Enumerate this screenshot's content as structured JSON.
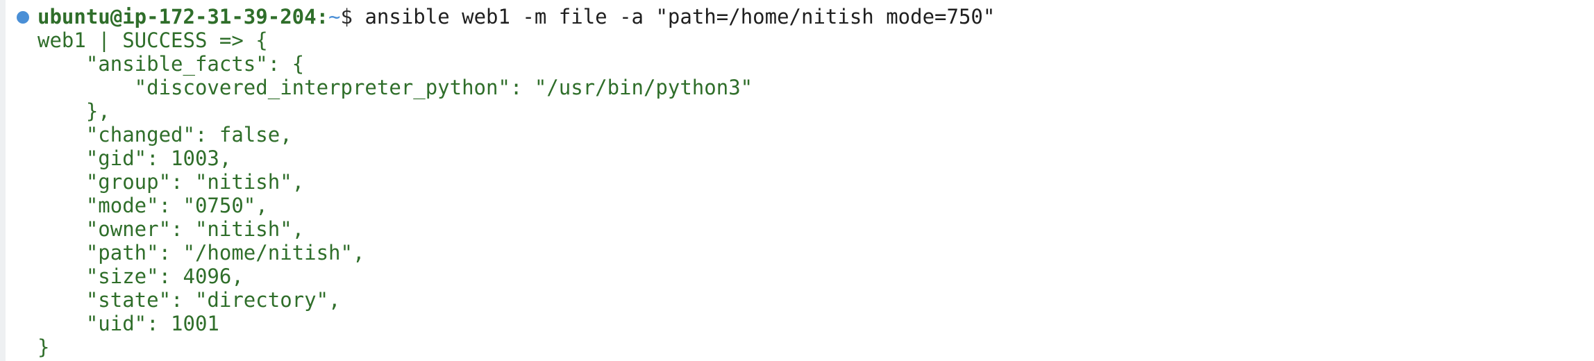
{
  "terminal": {
    "prompt": {
      "user_host": "ubuntu@ip-172-31-39-204",
      "colon": ":",
      "path": "~",
      "symbol": "$"
    },
    "command": " ansible web1 -m file -a \"path=/home/nitish mode=750\"",
    "output_lines": [
      "web1 | SUCCESS => {",
      "    \"ansible_facts\": {",
      "        \"discovered_interpreter_python\": \"/usr/bin/python3\"",
      "    },",
      "    \"changed\": false,",
      "    \"gid\": 1003,",
      "    \"group\": \"nitish\",",
      "    \"mode\": \"0750\",",
      "    \"owner\": \"nitish\",",
      "    \"path\": \"/home/nitish\",",
      "    \"size\": 4096,",
      "    \"state\": \"directory\",",
      "    \"uid\": 1001",
      "}"
    ],
    "colors": {
      "output_green": "#2f6e2a",
      "marker_blue": "#4a8fd6",
      "command_text": "#1f1f1f"
    }
  }
}
